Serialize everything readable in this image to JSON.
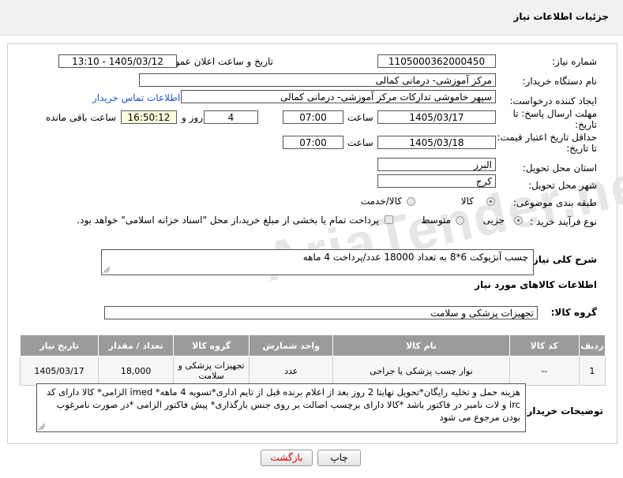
{
  "header": {
    "title": "جزئیات اطلاعات نیاز"
  },
  "form": {
    "need_number_label": "شماره نیاز:",
    "need_number": "1105000362000450",
    "announce_label": "تاریخ و ساعت اعلان عمومی:",
    "announce_value": "1405/03/12 - 13:10",
    "buyer_label": "نام دستگاه خریدار:",
    "buyer_value": "مرکز آموزشی- درمانی کمالی",
    "creator_label": "ایجاد کننده درخواست:",
    "creator_value": "سپهر خاموشی تدارکات مرکز آموزشی- درمانی کمالی",
    "contact_link": "اطلاعات تماس خریدار",
    "deadline_label_1": "مهلت ارسال پاسخ: تا",
    "deadline_label_2": "تاریخ:",
    "deadline_date": "1405/03/17",
    "time_label": "ساعت",
    "deadline_time": "07:00",
    "days_value": "4",
    "days_label": "روز و",
    "remaining_time": "16:50:12",
    "remaining_label": "ساعت باقی مانده",
    "validity_label_1": "حداقل تاریخ اعتبار قیمت:",
    "validity_label_2": "تا تاریخ:",
    "validity_date": "1405/03/18",
    "validity_time": "07:00",
    "province_label": "استان محل تحویل:",
    "province_value": "البرز",
    "city_label": "شهر محل تحویل:",
    "city_value": "کرج",
    "category_label": "طبقه بندی موضوعی:",
    "category_options": [
      "کالا",
      "کالا/خدمت"
    ],
    "process_label": "نوع فرآیند خرید :",
    "process_options": [
      "جزیی",
      "متوسط"
    ],
    "payment_text": "پرداخت تمام یا بخشی از مبلغ خرید،از محل \"اسناد خزانه اسلامی\" خواهد بود.",
    "summary_label": "شرح کلی نیاز:",
    "summary_value": "چسب آنژیوکت 6*8 به تعداد 18000 عدد/پرداخت 4 ماهه",
    "goods_info_title": "اطلاعات کالاهای مورد نیاز",
    "goods_group_label": "گروه کالا:",
    "goods_group_value": "تجهیزات پزشکی و سلامت"
  },
  "table": {
    "headers": [
      "ردیف",
      "کد کالا",
      "نام کالا",
      "واحد شمارش",
      "گروه کالا",
      "تعداد / مقدار",
      "تاریخ نیاز"
    ],
    "rows": [
      [
        "1",
        "--",
        "نوار چسب پزشکی یا جراحی",
        "عدد",
        "تجهیزات پزشکی و سلامت",
        "18,000",
        "1405/03/17"
      ]
    ]
  },
  "notes": {
    "label": "توضیحات خریدار:",
    "text": "هزینه حمل و تخلیه رایگان*تحویل نهایتا 2 روز بعد از اعلام برنده قبل از تایم اداری*تسویه 4 ماهه* imed الزامی* کالا دارای کد irc و لات نامبر در فاکتور باشد *کالا دارای برچسب اصالت بر روی جنس بارگذاری* پیش فاکتور الزامی *در صورت نامرغوب بودن مرجوع می شود"
  },
  "buttons": {
    "print": "چاپ",
    "back": "بازگشت"
  },
  "watermark": "AriaTender.net"
}
